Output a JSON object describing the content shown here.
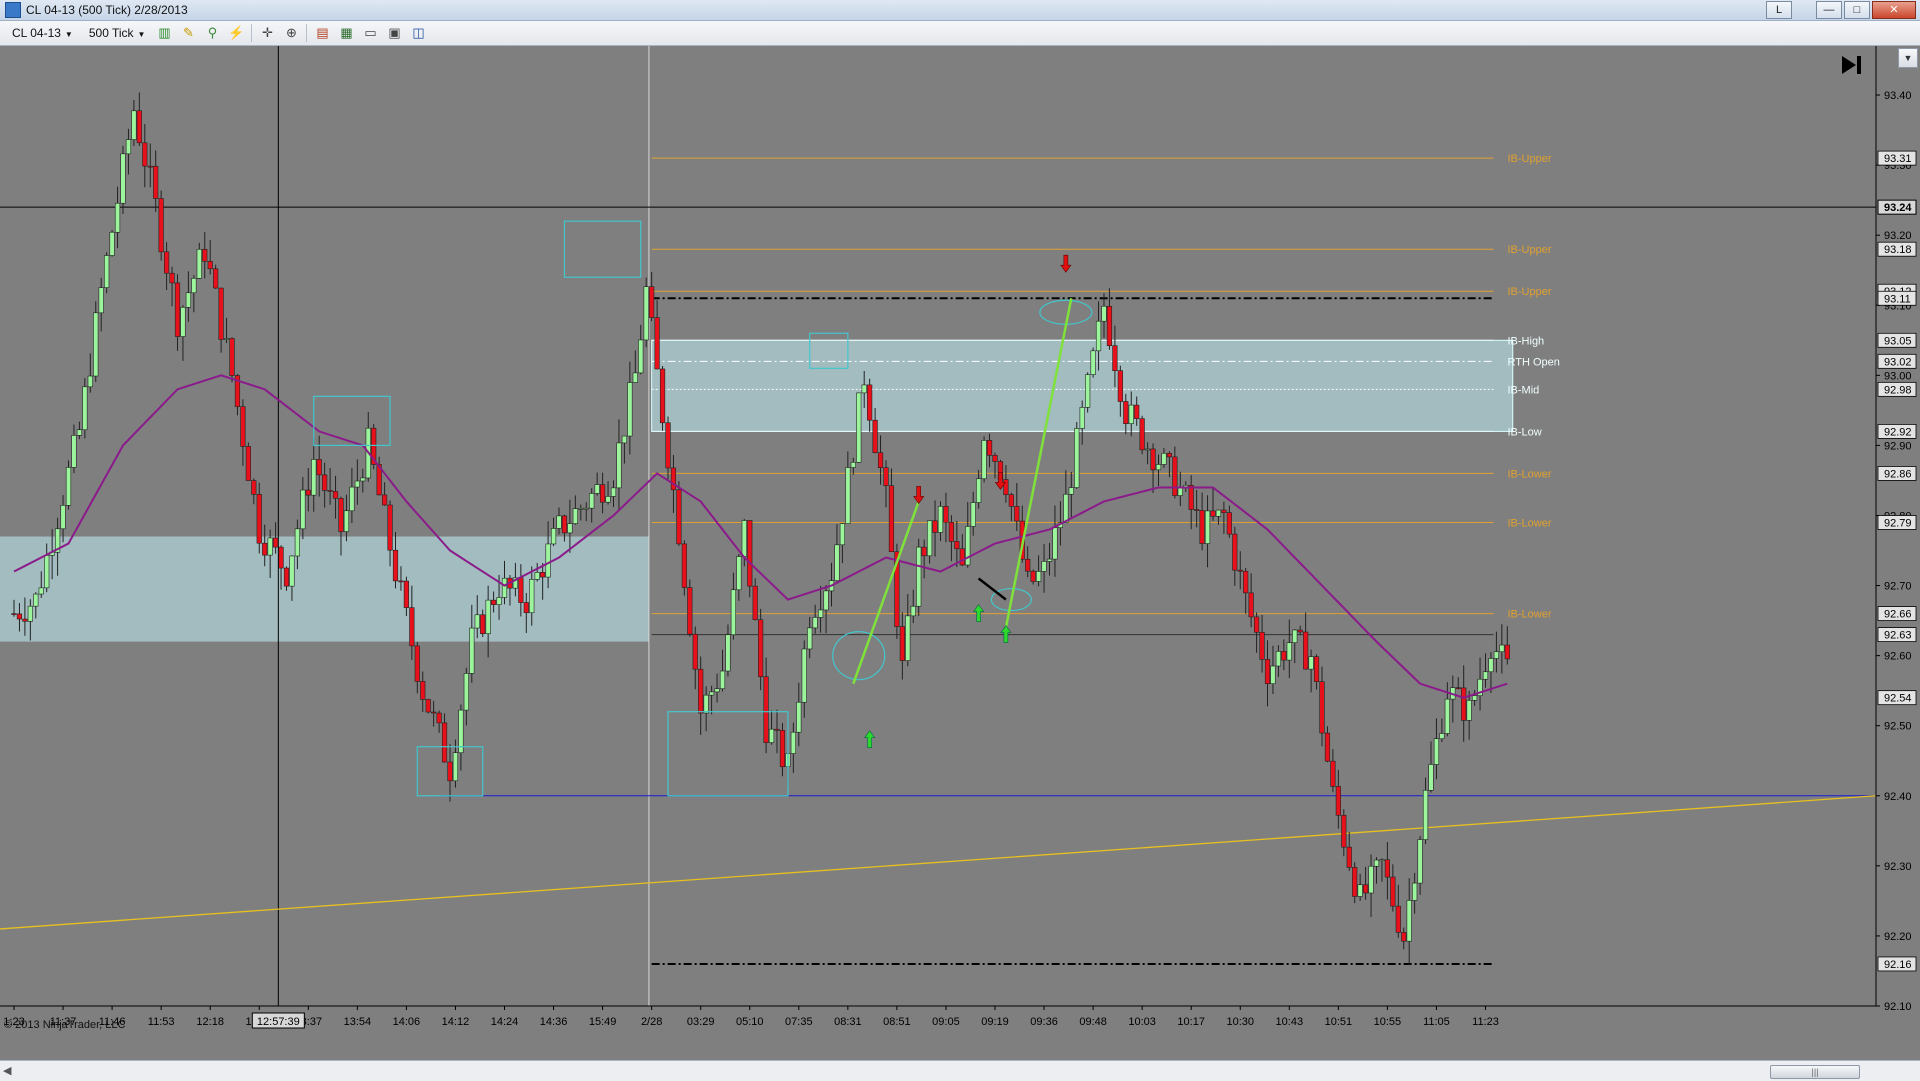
{
  "window": {
    "title": "CL 04-13 (500 Tick)  2/28/2013",
    "letter_btn": "L",
    "minimize_icon": "minimize-icon",
    "maximize_icon": "maximize-icon",
    "close_icon": "close-icon"
  },
  "toolbar": {
    "instrument": "CL 04-13",
    "interval": "500 Tick",
    "icons": [
      "bar-type-icon",
      "drawing-tool-icon",
      "indicator-icon",
      "strategy-icon",
      "crosshair-icon",
      "zoom-icon",
      "properties-icon",
      "data-box-icon",
      "chart-trader-icon",
      "order-icon",
      "layout-icon"
    ]
  },
  "copyright": "© 2013 NinjaTrader, LLC",
  "scroll_to_end_icon": "skip-to-end-icon",
  "colors": {
    "background": "#7f7f7f",
    "up_candle": "#9cf59c",
    "down_candle": "#e8101a",
    "sma": "#8b1a8b",
    "ib_range": "#a8c7cb",
    "level_orange": "#e0a030",
    "trend_yellow": "#e8c020",
    "blue_line": "#1a1ad0",
    "cyan": "#43c6cc",
    "green_line": "#7fe23a"
  },
  "chart_data": {
    "type": "candlestick",
    "ylim": [
      92.1,
      93.45
    ],
    "y_ticks": [
      92.1,
      92.2,
      92.3,
      92.4,
      92.5,
      92.6,
      92.7,
      92.8,
      92.9,
      93.0,
      93.1,
      93.2,
      93.3,
      93.4
    ],
    "y_tick_labels": [
      "92.10",
      "92.20",
      "92.30",
      "92.40",
      "92.50",
      "92.60",
      "92.70",
      "92.80",
      "92.90",
      "93.00",
      "93.10",
      "93.20",
      "93.30",
      "93.40"
    ],
    "x_tick_labels": [
      {
        "i": 0,
        "t": "1:23"
      },
      {
        "i": 9,
        "t": "11:37"
      },
      {
        "i": 18,
        "t": "11:46"
      },
      {
        "i": 27,
        "t": "11:53"
      },
      {
        "i": 36,
        "t": "12:18"
      },
      {
        "i": 45,
        "t": "12:44"
      },
      {
        "i": 54,
        "t": "13:37"
      },
      {
        "i": 63,
        "t": "13:54"
      },
      {
        "i": 72,
        "t": "14:06"
      },
      {
        "i": 81,
        "t": "14:12"
      },
      {
        "i": 90,
        "t": "14:24"
      },
      {
        "i": 99,
        "t": "14:36"
      },
      {
        "i": 108,
        "t": "15:49"
      },
      {
        "i": 117,
        "t": "2/28"
      },
      {
        "i": 126,
        "t": "03:29"
      },
      {
        "i": 135,
        "t": "05:10"
      },
      {
        "i": 144,
        "t": "07:35"
      },
      {
        "i": 153,
        "t": "08:31"
      },
      {
        "i": 162,
        "t": "08:51"
      },
      {
        "i": 171,
        "t": "09:05"
      },
      {
        "i": 180,
        "t": "09:19"
      },
      {
        "i": 189,
        "t": "09:36"
      },
      {
        "i": 198,
        "t": "09:48"
      },
      {
        "i": 207,
        "t": "10:03"
      },
      {
        "i": 216,
        "t": "10:17"
      },
      {
        "i": 225,
        "t": "10:30"
      },
      {
        "i": 234,
        "t": "10:43"
      },
      {
        "i": 243,
        "t": "10:51"
      },
      {
        "i": 252,
        "t": "10:55"
      },
      {
        "i": 261,
        "t": "11:05"
      },
      {
        "i": 270,
        "t": "11:23"
      }
    ],
    "cursor": {
      "i": 48.5,
      "price": 93.24,
      "time_label": "12:57:39",
      "price_label": "93.24"
    },
    "session_break_i": 116.5,
    "waypoints": [
      [
        0,
        92.66
      ],
      [
        4,
        92.68
      ],
      [
        8,
        92.8
      ],
      [
        12,
        92.92
      ],
      [
        16,
        93.12
      ],
      [
        22,
        93.38
      ],
      [
        26,
        93.24
      ],
      [
        30,
        93.08
      ],
      [
        35,
        93.18
      ],
      [
        40,
        93.0
      ],
      [
        45,
        92.78
      ],
      [
        50,
        92.72
      ],
      [
        55,
        92.88
      ],
      [
        60,
        92.78
      ],
      [
        65,
        92.9
      ],
      [
        70,
        92.72
      ],
      [
        75,
        92.55
      ],
      [
        80,
        92.44
      ],
      [
        84,
        92.62
      ],
      [
        89,
        92.7
      ],
      [
        94,
        92.68
      ],
      [
        100,
        92.78
      ],
      [
        105,
        92.82
      ],
      [
        110,
        92.86
      ],
      [
        114,
        93.0
      ],
      [
        116,
        93.12
      ],
      [
        118,
        93.0
      ],
      [
        122,
        92.78
      ],
      [
        126,
        92.52
      ],
      [
        130,
        92.58
      ],
      [
        134,
        92.78
      ],
      [
        138,
        92.5
      ],
      [
        142,
        92.44
      ],
      [
        146,
        92.66
      ],
      [
        150,
        92.72
      ],
      [
        153,
        92.85
      ],
      [
        156,
        93.0
      ],
      [
        160,
        92.82
      ],
      [
        163,
        92.58
      ],
      [
        166,
        92.74
      ],
      [
        170,
        92.8
      ],
      [
        174,
        92.72
      ],
      [
        178,
        92.92
      ],
      [
        182,
        92.85
      ],
      [
        186,
        92.7
      ],
      [
        189,
        92.72
      ],
      [
        193,
        92.82
      ],
      [
        197,
        92.98
      ],
      [
        200,
        93.1
      ],
      [
        204,
        92.95
      ],
      [
        208,
        92.9
      ],
      [
        213,
        92.85
      ],
      [
        218,
        92.78
      ],
      [
        222,
        92.8
      ],
      [
        226,
        92.68
      ],
      [
        230,
        92.58
      ],
      [
        234,
        92.62
      ],
      [
        238,
        92.6
      ],
      [
        242,
        92.4
      ],
      [
        247,
        92.25
      ],
      [
        251,
        92.3
      ],
      [
        255,
        92.2
      ],
      [
        259,
        92.4
      ],
      [
        263,
        92.55
      ],
      [
        267,
        92.52
      ],
      [
        271,
        92.62
      ],
      [
        274,
        92.58
      ]
    ],
    "sma_waypoints": [
      [
        0,
        92.72
      ],
      [
        10,
        92.76
      ],
      [
        20,
        92.9
      ],
      [
        30,
        92.98
      ],
      [
        38,
        93.0
      ],
      [
        46,
        92.98
      ],
      [
        56,
        92.92
      ],
      [
        64,
        92.9
      ],
      [
        72,
        92.82
      ],
      [
        80,
        92.75
      ],
      [
        90,
        92.7
      ],
      [
        100,
        92.74
      ],
      [
        110,
        92.8
      ],
      [
        118,
        92.86
      ],
      [
        126,
        92.82
      ],
      [
        134,
        92.74
      ],
      [
        142,
        92.68
      ],
      [
        150,
        92.7
      ],
      [
        160,
        92.74
      ],
      [
        170,
        92.72
      ],
      [
        180,
        92.76
      ],
      [
        190,
        92.78
      ],
      [
        200,
        92.82
      ],
      [
        210,
        92.84
      ],
      [
        220,
        92.84
      ],
      [
        230,
        92.78
      ],
      [
        240,
        92.7
      ],
      [
        250,
        92.62
      ],
      [
        258,
        92.56
      ],
      [
        266,
        92.54
      ],
      [
        274,
        92.56
      ]
    ],
    "ib_zone_prior": {
      "i0": 0,
      "i1": 116.5,
      "low": 92.62,
      "high": 92.77
    },
    "ib_zone_today": {
      "i0": 117,
      "i1": 275,
      "low": 92.92,
      "high": 93.05
    },
    "levels": [
      {
        "price": 93.31,
        "label": "IB-Upper",
        "axis_label": "93.31",
        "style": "orange"
      },
      {
        "price": 93.18,
        "label": "IB-Upper",
        "axis_label": "93.18",
        "style": "orange"
      },
      {
        "price": 93.12,
        "label": "IB-Upper",
        "axis_label": "93.12",
        "style": "orange"
      },
      {
        "price": 93.11,
        "label": "",
        "axis_label": "93.11",
        "style": "black-dash"
      },
      {
        "price": 93.05,
        "label": "IB-High",
        "axis_label": "93.05",
        "style": "white"
      },
      {
        "price": 93.02,
        "label": "RTH Open",
        "axis_label": "93.02",
        "style": "white-dash"
      },
      {
        "price": 92.98,
        "label": "IB-Mid",
        "axis_label": "92.98",
        "style": "white-dot"
      },
      {
        "price": 92.92,
        "label": "IB-Low",
        "axis_label": "92.92",
        "style": "white"
      },
      {
        "price": 92.86,
        "label": "IB-Lower",
        "axis_label": "92.86",
        "style": "orange"
      },
      {
        "price": 92.79,
        "label": "IB-Lower",
        "axis_label": "92.79",
        "style": "orange"
      },
      {
        "price": 92.66,
        "label": "IB-Lower",
        "axis_label": "92.66",
        "style": "orange"
      },
      {
        "price": 92.63,
        "label": "",
        "axis_label": "92.63",
        "style": "gray-thin"
      },
      {
        "price": 92.16,
        "label": "",
        "axis_label": "92.16",
        "style": "black-dash"
      }
    ],
    "extra_axis_labels": [
      {
        "price": 92.54,
        "label": "92.54"
      }
    ],
    "blue_line": {
      "i0": 78,
      "i1": 275,
      "price": 92.4
    },
    "trend_line": {
      "i0": 0,
      "p0": 92.21,
      "i1": 275,
      "p1": 92.4
    },
    "rectangles": [
      {
        "i0": 101,
        "i1": 115,
        "p0": 93.14,
        "p1": 93.22
      },
      {
        "i0": 55,
        "i1": 69,
        "p0": 92.9,
        "p1": 92.97
      },
      {
        "i0": 74,
        "i1": 86,
        "p0": 92.4,
        "p1": 92.47
      },
      {
        "i0": 120,
        "i1": 142,
        "p0": 92.4,
        "p1": 92.52
      },
      {
        "i0": 146,
        "i1": 153,
        "p0": 93.01,
        "p1": 93.06
      }
    ],
    "ellipses": [
      {
        "i": 155,
        "p": 92.6,
        "rx": 26,
        "ry": 24
      },
      {
        "i": 183,
        "p": 92.68,
        "rx": 20,
        "ry": 11
      },
      {
        "i": 193,
        "p": 93.09,
        "rx": 26,
        "ry": 12
      }
    ],
    "green_lines": [
      {
        "i0": 154,
        "p0": 92.56,
        "i1": 166,
        "p1": 92.82
      },
      {
        "i0": 182,
        "p0": 92.64,
        "i1": 194,
        "p1": 93.11
      }
    ],
    "black_arrow": {
      "i0": 177,
      "p0": 92.71,
      "i1": 182,
      "p1": 92.68
    },
    "arrows": [
      {
        "i": 157,
        "p": 92.48,
        "dir": "up"
      },
      {
        "i": 177,
        "p": 92.66,
        "dir": "up"
      },
      {
        "i": 182,
        "p": 92.63,
        "dir": "up"
      },
      {
        "i": 166,
        "p": 92.83,
        "dir": "down"
      },
      {
        "i": 181,
        "p": 92.85,
        "dir": "down"
      },
      {
        "i": 193,
        "p": 93.16,
        "dir": "down"
      }
    ]
  }
}
